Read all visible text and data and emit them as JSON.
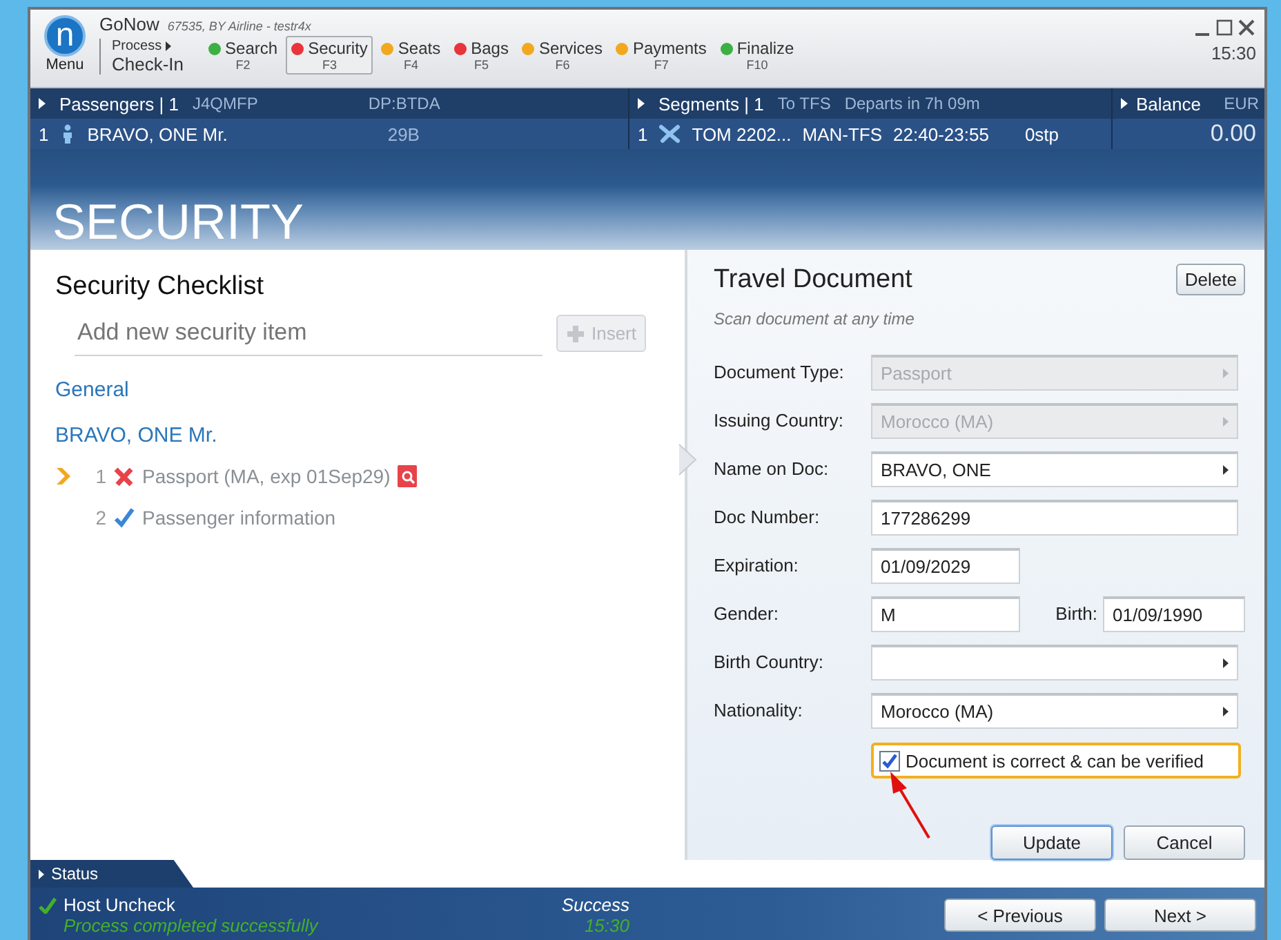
{
  "app": {
    "logo_letter": "n",
    "menu_label": "Menu",
    "title": "GoNow",
    "subtitle": "67535, BY Airline - testr4x",
    "time": "15:30"
  },
  "process": {
    "label": "Process",
    "value": "Check-In"
  },
  "steps": [
    {
      "label": "Search",
      "key": "F2",
      "color": "#3cb043",
      "selected": false
    },
    {
      "label": "Security",
      "key": "F3",
      "color": "#e8343a",
      "selected": true
    },
    {
      "label": "Seats",
      "key": "F4",
      "color": "#f2a81d",
      "selected": false
    },
    {
      "label": "Bags",
      "key": "F5",
      "color": "#e8343a",
      "selected": false
    },
    {
      "label": "Services",
      "key": "F6",
      "color": "#f2a81d",
      "selected": false
    },
    {
      "label": "Payments",
      "key": "F7",
      "color": "#f2a81d",
      "selected": false
    },
    {
      "label": "Finalize",
      "key": "F10",
      "color": "#3cb043",
      "selected": false
    }
  ],
  "passengers": {
    "title": "Passengers | 1",
    "record": "J4QMFP",
    "code": "DP:BTDA",
    "row": {
      "number": "1",
      "name": "BRAVO, ONE Mr.",
      "seat": "29B"
    }
  },
  "segments": {
    "title": "Segments | 1",
    "destination": "To TFS",
    "departs": "Departs in 7h 09m",
    "row": {
      "number": "1",
      "flight": "TOM 2202...",
      "route": "MAN-TFS",
      "time": "22:40-23:55",
      "stops": "0stp"
    }
  },
  "balance": {
    "title": "Balance",
    "currency": "EUR",
    "amount": "0.00"
  },
  "page_title": "SECURITY",
  "checklist": {
    "title": "Security Checklist",
    "placeholder": "Add new security item",
    "insert_button": "Insert",
    "groups": [
      {
        "title": "General"
      },
      {
        "title": "BRAVO, ONE Mr.",
        "items": [
          {
            "number": "1",
            "label": "Passport (MA, exp 01Sep29)",
            "passed": false,
            "has_scan": true,
            "selected": true
          },
          {
            "number": "2",
            "label": "Passenger information",
            "passed": true,
            "has_scan": false,
            "selected": false
          }
        ]
      }
    ]
  },
  "document": {
    "title": "Travel Document",
    "delete_button": "Delete",
    "hint": "Scan document at any time",
    "fields": [
      {
        "label": "Document Type:",
        "value": "Passport",
        "kind": "select",
        "disabled": true
      },
      {
        "label": "Issuing Country:",
        "value": "Morocco (MA)",
        "kind": "select",
        "disabled": true
      },
      {
        "label": "Name on Doc:",
        "value": "BRAVO, ONE",
        "kind": "select",
        "disabled": false
      },
      {
        "label": "Doc Number:",
        "value": "177286299",
        "kind": "text",
        "disabled": false
      },
      {
        "label": "Expiration:",
        "value": "01/09/2029",
        "kind": "short",
        "disabled": false
      },
      {
        "label": "Gender:",
        "value": "M",
        "kind": "short",
        "disabled": false,
        "extra": {
          "label": "Birth:",
          "value": "01/09/1990"
        }
      },
      {
        "label": "Birth Country:",
        "kind": "select",
        "disabled": false
      },
      {
        "label": "Nationality:",
        "value": "Morocco (MA)",
        "kind": "select",
        "disabled": false
      }
    ],
    "verified": {
      "label": "Document is correct & can be verified",
      "checked": true,
      "focused": true
    },
    "update_button": "Update",
    "cancel_button": "Cancel"
  },
  "status": {
    "tab": "Status",
    "message": "Host Uncheck",
    "detail": "Process completed successfully",
    "result": "Success",
    "time": "15:30"
  },
  "nav": {
    "previous": "< Previous",
    "next": "Next >"
  }
}
